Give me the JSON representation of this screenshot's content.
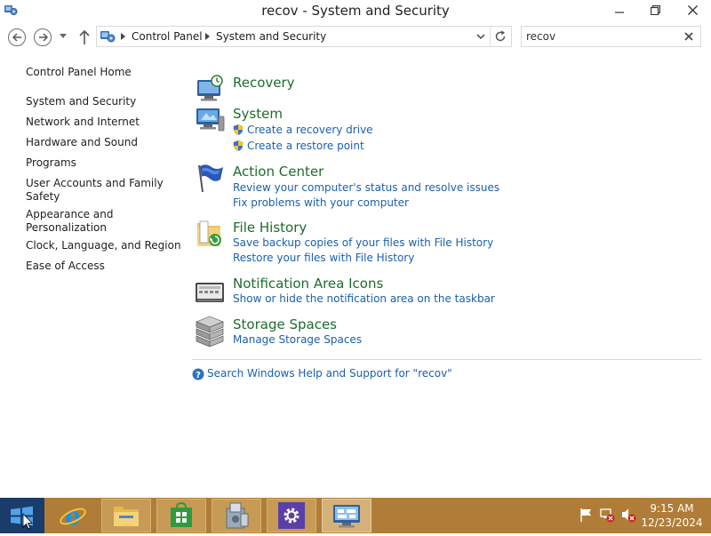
{
  "window": {
    "title": "recov - System and Security"
  },
  "navigation": {
    "breadcrumb": [
      "Control Panel",
      "System and Security"
    ],
    "search_value": "recov"
  },
  "left_pane": {
    "items": [
      "Control Panel Home",
      "System and Security",
      "Network and Internet",
      "Hardware and Sound",
      "Programs",
      "User Accounts and Family",
      "Safety",
      "Appearance and",
      "Personalization",
      "Clock, Language, and Region",
      "Ease of Access"
    ]
  },
  "results": [
    {
      "title": "Recovery",
      "icon": "recovery-icon",
      "tasks": []
    },
    {
      "title": "System",
      "icon": "system-icon",
      "tasks": [
        {
          "label": "Create a recovery drive",
          "shield": true
        },
        {
          "label": "Create a restore point",
          "shield": true
        }
      ]
    },
    {
      "title": "Action Center",
      "icon": "action-center-flag-icon",
      "tasks": [
        {
          "label": "Review your computer's status and resolve issues",
          "shield": false
        },
        {
          "label": "Fix problems with your computer",
          "shield": false
        }
      ]
    },
    {
      "title": "File History",
      "icon": "file-history-icon",
      "tasks": [
        {
          "label": "Save backup copies of your files with File History",
          "shield": false
        },
        {
          "label": "Restore your files with File History",
          "shield": false
        }
      ]
    },
    {
      "title": "Notification Area Icons",
      "icon": "notification-area-icon",
      "tasks": [
        {
          "label": "Show or hide the notification area on the taskbar",
          "shield": false
        }
      ]
    },
    {
      "title": "Storage Spaces",
      "icon": "storage-spaces-icon",
      "tasks": [
        {
          "label": "Manage Storage Spaces",
          "shield": false
        }
      ]
    }
  ],
  "help_link": "Search Windows Help and Support for \"recov\"",
  "taskbar": {
    "time": "9:15 AM",
    "date": "12/23/2024",
    "apps": [
      "internet-explorer",
      "file-explorer",
      "store",
      "setup",
      "settings",
      "control-panel"
    ]
  },
  "colors": {
    "category_title": "#1e6b2e",
    "task_link": "#1c5fb0",
    "taskbar": "#b07d38",
    "start": "#1b3b6a"
  }
}
